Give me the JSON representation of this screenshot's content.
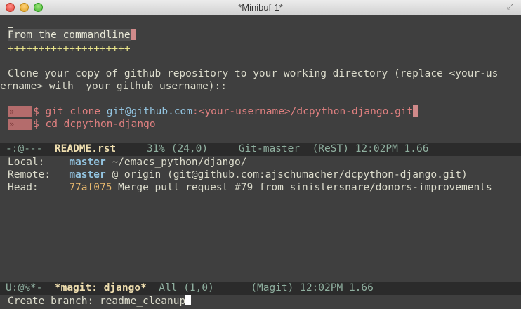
{
  "window": {
    "title": "*Minibuf-1*"
  },
  "buffer_top": {
    "heading": "From the commandline",
    "heading_underline": "++++++++++++++++++++",
    "para_line1": "Clone your copy of github repository to your working directory (replace <your-us",
    "para_line2": "ername> with  your github username)::",
    "gutter_marker": "»",
    "cmd1_prompt": "$ git clone ",
    "cmd1_link": "git@github.com",
    "cmd1_rest": ":<your-username>/dcpython-django.git",
    "cmd2": "$ cd dcpython-django"
  },
  "modeline_top": {
    "flags": "-:@---",
    "buffer_name": "README.rst",
    "position": "31% (24,0)",
    "vc": "Git-master",
    "mode": "(ReST)",
    "time": "12:02PM",
    "load": "1.66"
  },
  "magit": {
    "local_label": "Local:",
    "local_branch": "master",
    "local_path": "~/emacs_python/django/",
    "remote_label": "Remote:",
    "remote_branch": "master",
    "remote_detail": "@ origin (git@github.com:ajschumacher/dcpython-django.git)",
    "head_label": "Head:",
    "head_hash": "77af075",
    "head_message": "Merge pull request #79 from sinistersnare/donors-improvements"
  },
  "modeline_bottom": {
    "flags": "U:@%*-",
    "buffer_name": "*magit: django*",
    "position": "All (1,0)",
    "mode": "(Magit)",
    "time": "12:02PM",
    "load": "1.66"
  },
  "minibuffer": {
    "prompt": "Create branch: ",
    "value": "readme_cleanup"
  }
}
